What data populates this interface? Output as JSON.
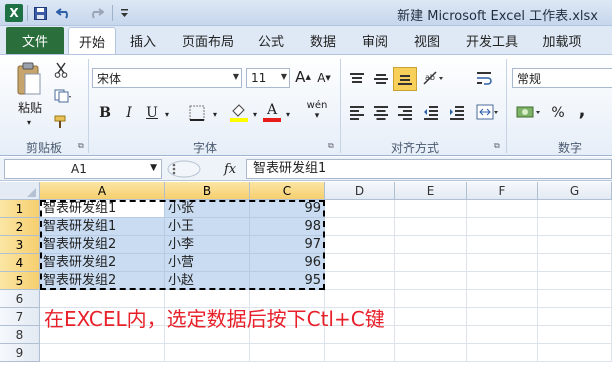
{
  "titlebar": {
    "app_icon": "excel-icon",
    "title": "新建 Microsoft Excel 工作表.xlsx"
  },
  "tabs": [
    {
      "label": "文件"
    },
    {
      "label": "开始"
    },
    {
      "label": "插入"
    },
    {
      "label": "页面布局"
    },
    {
      "label": "公式"
    },
    {
      "label": "数据"
    },
    {
      "label": "审阅"
    },
    {
      "label": "视图"
    },
    {
      "label": "开发工具"
    },
    {
      "label": "加载项"
    }
  ],
  "active_tab": "开始",
  "ribbon": {
    "clipboard": {
      "paste_label": "粘贴",
      "group_label": "剪贴板"
    },
    "font": {
      "font_name": "宋体",
      "font_size": "11",
      "bold": "B",
      "italic": "I",
      "underline": "U",
      "font_color_glyph": "A",
      "phonetic": "wén",
      "group_label": "字体",
      "grow": "A",
      "shrink": "A"
    },
    "alignment": {
      "group_label": "对齐方式"
    },
    "number": {
      "format": "常规",
      "percent": "%",
      "comma": ",",
      "group_label": "数字"
    }
  },
  "formula_bar": {
    "name_box": "A1",
    "fx": "fx",
    "content": "智表研发组1"
  },
  "columns": [
    "A",
    "B",
    "C",
    "D",
    "E",
    "F",
    "G"
  ],
  "rows": [
    {
      "num": "1",
      "a": "智表研发组1",
      "b": "小张",
      "c": "99"
    },
    {
      "num": "2",
      "a": "智表研发组1",
      "b": "小王",
      "c": "98"
    },
    {
      "num": "3",
      "a": "智表研发组2",
      "b": "小李",
      "c": "97"
    },
    {
      "num": "4",
      "a": "智表研发组2",
      "b": "小营",
      "c": "96"
    },
    {
      "num": "5",
      "a": "智表研发组2",
      "b": "小赵",
      "c": "95"
    },
    {
      "num": "6",
      "a": "",
      "b": "",
      "c": ""
    },
    {
      "num": "7",
      "a": "",
      "b": "",
      "c": ""
    },
    {
      "num": "8",
      "a": "",
      "b": "",
      "c": ""
    },
    {
      "num": "9",
      "a": "",
      "b": "",
      "c": ""
    }
  ],
  "annotation": "在EXCEL内，选定数据后按下Ctl+C键",
  "colors": {
    "file_tab": "#2a6e3c",
    "selection": "#c9dcf2",
    "annotation": "#e8202a",
    "highlight_header": "#f6cf6f"
  }
}
